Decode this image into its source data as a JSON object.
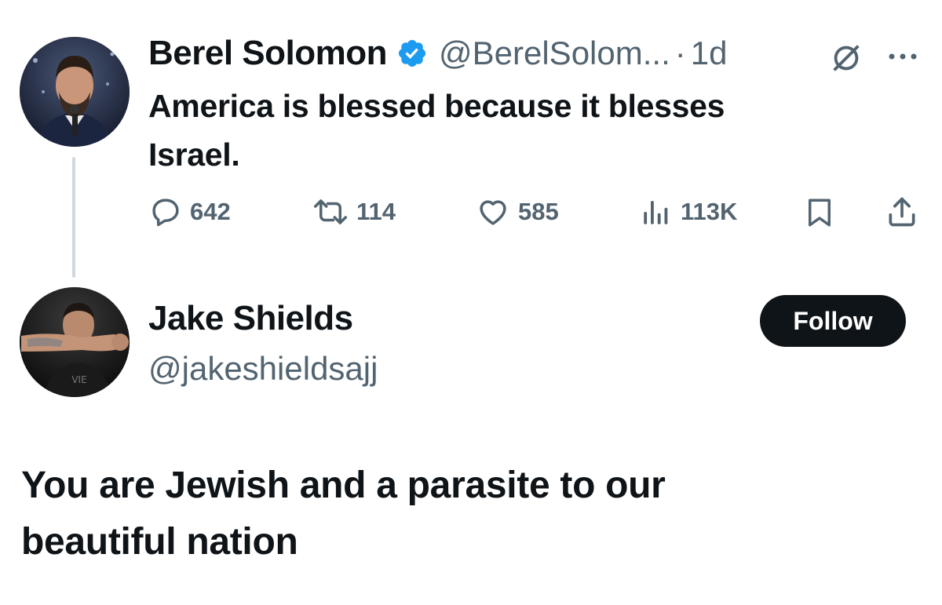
{
  "original_tweet": {
    "author_name": "Berel Solomon",
    "handle": "@BerelSolom...",
    "time_separator": "·",
    "time": "1d",
    "text_line1": "America is blessed because it blesses",
    "text_line2": "Israel.",
    "icons": [
      "verified-badge-icon",
      "grok-icon",
      "more-icon"
    ],
    "actions": {
      "replies": "642",
      "reposts": "114",
      "likes": "585",
      "views": "113K"
    }
  },
  "reply_tweet": {
    "author_name": "Jake Shields",
    "handle": "@jakeshieldsajj",
    "follow_label": "Follow",
    "text_line1": "You are Jewish and a parasite to our",
    "text_line2": "beautiful nation"
  },
  "colors": {
    "text": "#0f1419",
    "muted": "#536471",
    "verified": "#1d9bf0",
    "follow_bg": "#0f1419",
    "thread_line": "#cfd9de"
  }
}
